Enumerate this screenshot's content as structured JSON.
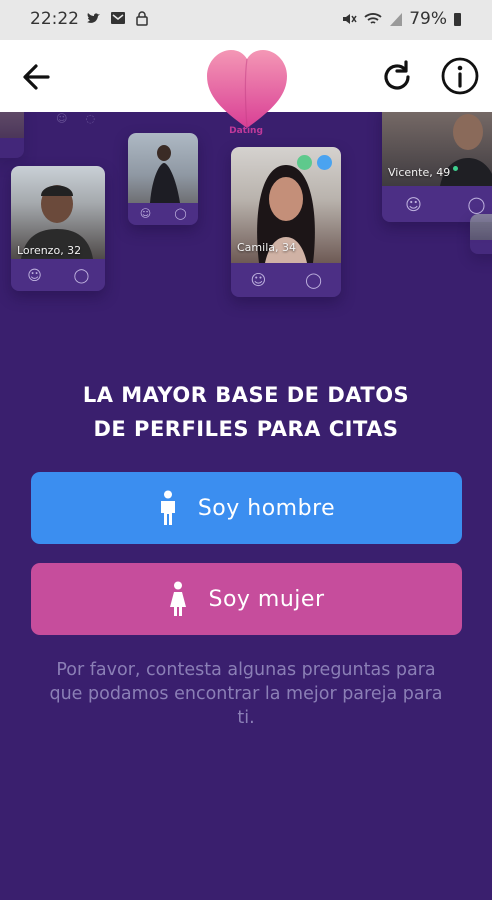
{
  "status": {
    "time": "22:22",
    "battery": "79%"
  },
  "app": {
    "logo_text": "Dating"
  },
  "cards": [
    {
      "name": "Lorenzo, 32"
    },
    {
      "name": "Camila, 34"
    },
    {
      "name": "Vicente, 49"
    }
  ],
  "main": {
    "headline_1": "LA MAYOR BASE DE DATOS",
    "headline_2": "DE PERFILES PARA CITAS",
    "man_label": "Soy hombre",
    "woman_label": "Soy mujer",
    "note": "Por favor, contesta algunas preguntas para que podamos encontrar la mejor pareja para ti."
  },
  "colors": {
    "background": "#3a1f6e",
    "man": "#3b8ef0",
    "woman": "#c64d9c",
    "note": "#8b7fb6"
  },
  "icons": [
    "twitter-icon",
    "mail-icon",
    "lock-icon",
    "mute-icon",
    "wifi-icon",
    "signal-icon",
    "battery-icon",
    "back-arrow-icon",
    "refresh-icon",
    "info-icon",
    "male-icon",
    "female-icon",
    "emoji-icon",
    "chat-icon"
  ]
}
